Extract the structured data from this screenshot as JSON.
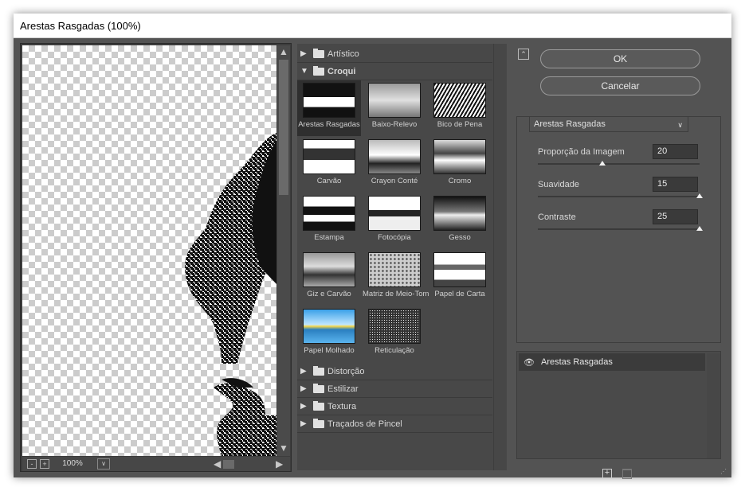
{
  "window": {
    "title": "Arestas Rasgadas (100%)"
  },
  "preview": {
    "zoom": "100%",
    "zoom_out": "-",
    "zoom_in": "+"
  },
  "gallery": {
    "categories_top": [
      {
        "label": "Artístico"
      },
      {
        "label": "Croqui"
      }
    ],
    "thumbnails": [
      {
        "label": "Arestas Rasgadas",
        "selected": true
      },
      {
        "label": "Baixo-Relevo"
      },
      {
        "label": "Bico de Pena"
      },
      {
        "label": "Carvão"
      },
      {
        "label": "Crayon Conté"
      },
      {
        "label": "Cromo"
      },
      {
        "label": "Estampa"
      },
      {
        "label": "Fotocópia"
      },
      {
        "label": "Gesso"
      },
      {
        "label": "Giz e Carvão"
      },
      {
        "label": "Matriz de Meio-Tom"
      },
      {
        "label": "Papel de Carta"
      },
      {
        "label": "Papel Molhado"
      },
      {
        "label": "Reticulação"
      }
    ],
    "categories_bottom": [
      {
        "label": "Distorção"
      },
      {
        "label": "Estilizar"
      },
      {
        "label": "Textura"
      },
      {
        "label": "Traçados de Pincel"
      }
    ]
  },
  "buttons": {
    "ok": "OK",
    "cancel": "Cancelar"
  },
  "filter": {
    "selected": "Arestas Rasgadas"
  },
  "params": [
    {
      "label": "Proporção da Imagem",
      "value": "20",
      "fraction": 0.4
    },
    {
      "label": "Suavidade",
      "value": "15",
      "fraction": 1.0
    },
    {
      "label": "Contraste",
      "value": "25",
      "fraction": 1.0
    }
  ],
  "layers": [
    {
      "name": "Arestas Rasgadas"
    }
  ],
  "colors": {
    "panel": "#535353",
    "dark": "#3b3b3b",
    "text": "#d8d8d8"
  }
}
